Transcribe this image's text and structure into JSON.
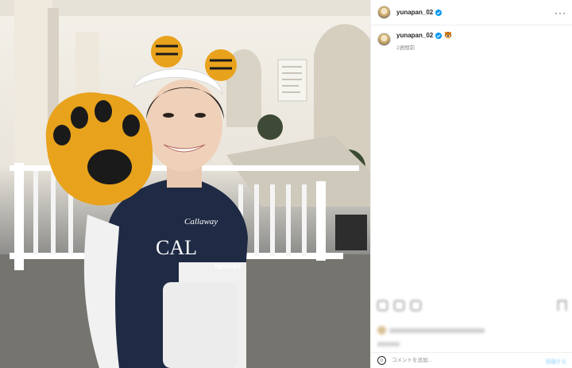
{
  "header": {
    "username": "yunapan_02",
    "verified_icon": "verified-badge-icon",
    "more_icon": "more-options-icon"
  },
  "caption": {
    "username": "yunapan_02",
    "text": "🐯",
    "time": "2週間前"
  },
  "actions": {
    "icons": [
      "heart-icon",
      "comment-icon",
      "share-icon"
    ],
    "bookmark_icon": "bookmark-icon"
  },
  "comment_box": {
    "placeholder": "コメントを追加...",
    "post_label": "投稿する",
    "emoji_icon": "emoji-icon"
  },
  "colors": {
    "accent": "#0095f6",
    "shirt": "#1f2a44",
    "mitt": "#e8a21c"
  },
  "photo": {
    "shirt_brand": "Callaway",
    "shirt_logo": "CAL",
    "sleeve_brand": "ODYSSEY"
  }
}
